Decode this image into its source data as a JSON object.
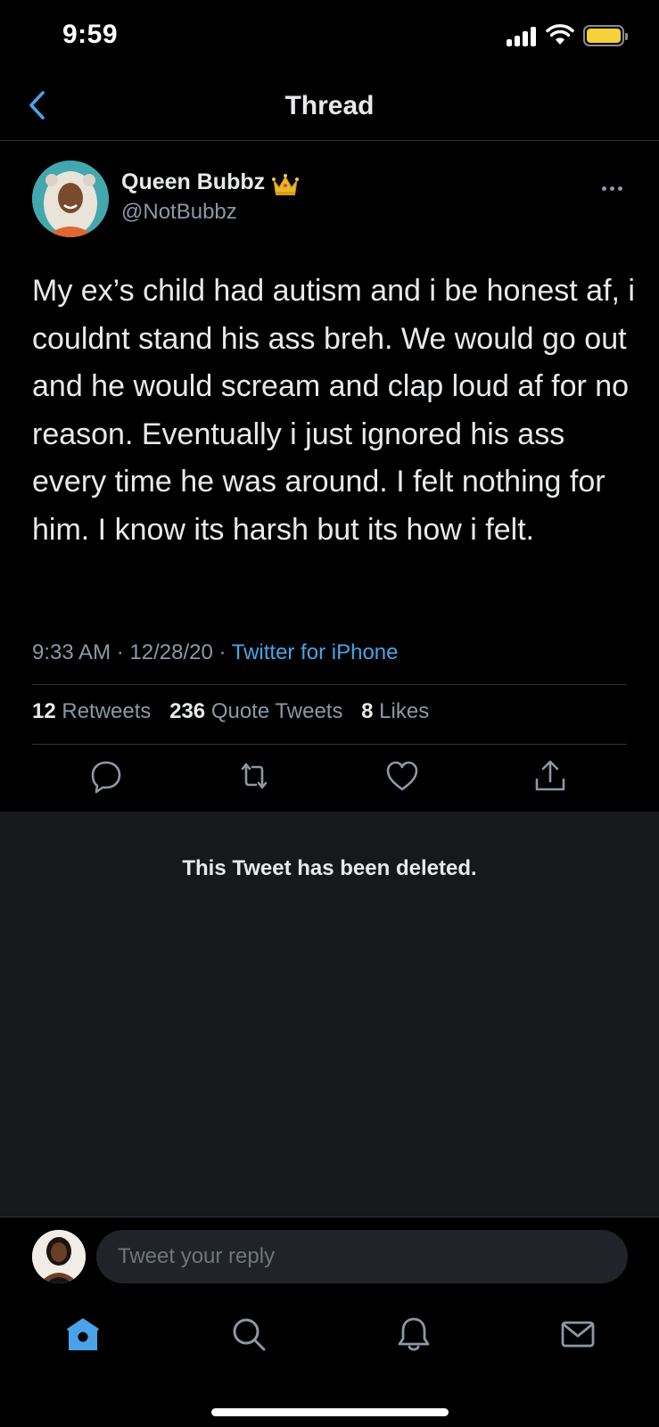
{
  "status_bar": {
    "time": "9:59"
  },
  "header": {
    "title": "Thread"
  },
  "tweet": {
    "display_name": "Queen Bubbz",
    "handle": "@NotBubbz",
    "text": "My ex’s child had autism and i be honest af, i couldnt stand his ass breh. We would go out and he would scream and clap loud af for no reason. Eventually i just ignored his ass every time he was around. I felt nothing for him. I know its harsh but its how i felt.",
    "time": "9:33 AM",
    "date": "12/28/20",
    "source": "Twitter for iPhone",
    "stats": {
      "retweets_count": "12",
      "retweets_label": "Retweets",
      "quote_count": "236",
      "quote_label": "Quote Tweets",
      "likes_count": "8",
      "likes_label": "Likes"
    }
  },
  "deleted_notice": "This Tweet has been deleted.",
  "reply": {
    "placeholder": "Tweet your reply"
  },
  "colors": {
    "accent": "#4aa3e8",
    "background": "#000000",
    "deleted_bg": "#17181c",
    "muted": "#8b98a5"
  },
  "icons": [
    "back-icon",
    "crown-icon",
    "more-icon",
    "reply-icon",
    "retweet-icon",
    "like-icon",
    "share-icon",
    "home-icon",
    "search-icon",
    "notifications-icon",
    "messages-icon"
  ]
}
